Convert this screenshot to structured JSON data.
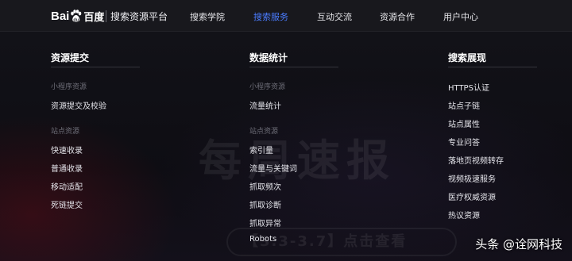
{
  "brand": {
    "logo_text_a": "Bai",
    "logo_text_b": "百度",
    "platform_title": "搜索资源平台"
  },
  "nav": {
    "items": [
      {
        "label": "搜索学院"
      },
      {
        "label": "搜索服务"
      },
      {
        "label": "互动交流"
      },
      {
        "label": "资源合作"
      },
      {
        "label": "用户中心"
      }
    ],
    "active_index": 1,
    "active_color": "#4a7cff"
  },
  "menu": {
    "columns": [
      {
        "title": "资源提交",
        "sections": [
          {
            "label": "小程序资源",
            "links": [
              "资源提交及校验"
            ]
          },
          {
            "label": "站点资源",
            "links": [
              "快速收录",
              "普通收录",
              "移动适配",
              "死链提交"
            ]
          }
        ]
      },
      {
        "title": "数据统计",
        "sections": [
          {
            "label": "小程序资源",
            "links": [
              "流量统计"
            ]
          },
          {
            "label": "站点资源",
            "links": [
              "索引量",
              "流量与关键词",
              "抓取频次",
              "抓取诊断",
              "抓取异常",
              "Robots"
            ]
          }
        ]
      },
      {
        "title": "搜索展现",
        "sections": [
          {
            "label": "",
            "links": [
              "HTTPS认证",
              "站点子链",
              "站点属性",
              "专业问答",
              "落地页视频转存",
              "视频极速服务",
              "医疗权威资源",
              "热议资源"
            ]
          }
        ]
      }
    ]
  },
  "background": {
    "ghost_title": "每周速报",
    "ghost_pill": "【3.3-3.7】点击查看"
  },
  "watermark": {
    "text": "头条 @诠网科技"
  }
}
